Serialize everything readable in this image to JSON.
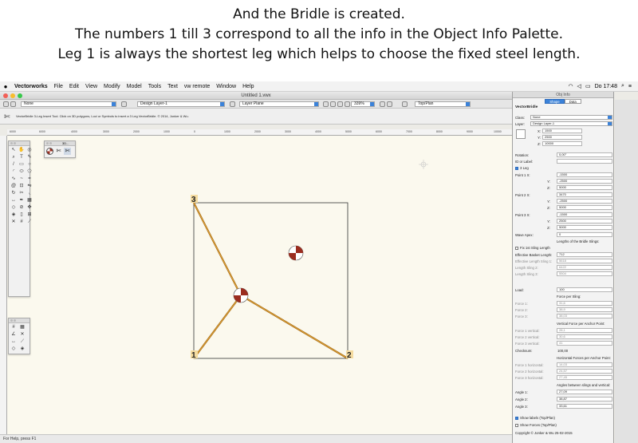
{
  "caption": {
    "line1": "And the Bridle is created.",
    "line2": "The numbers 1 till 3 correspond to all the info in the Object Info Palette.",
    "line3": "Leg 1 is always the shortest leg which helps to choose the fixed steel length."
  },
  "menubar": {
    "apple": "",
    "items": [
      "Vectorworks",
      "File",
      "Edit",
      "View",
      "Modify",
      "Model",
      "Tools",
      "Text",
      "vw remote",
      "Window",
      "Help"
    ],
    "clock": "Do 17:48"
  },
  "window": {
    "title": "Untitled 1.vwx"
  },
  "toolbar": {
    "class_select": "None",
    "layer_select": "Design Layer-1",
    "plane_select": "Layer Plane",
    "zoom": "339%",
    "view_select": "Top/Plan"
  },
  "modebar": {
    "message": "VectorBridle 3-Leg Insert Tool. Click on 3D polygons, Loci or Symbols to insert a 3 Leg VectorBridle. © 2014, Jonker & Wu."
  },
  "ruler": {
    "ticks": [
      "6000",
      "6000",
      "4000",
      "3000",
      "2000",
      "1000",
      "0",
      "1000",
      "2000",
      "3000",
      "4000",
      "5000",
      "6000",
      "7000",
      "8000",
      "9000",
      "10000"
    ]
  },
  "palette": {
    "title": "3D..."
  },
  "status": {
    "text": "For Help, press F1"
  },
  "drawing": {
    "point_labels": [
      "3",
      "1",
      "2"
    ],
    "line_color": "#c8861e",
    "marker_dark": "#9b2d1f"
  },
  "oip": {
    "title": "Obj Info",
    "tabs": [
      "Shape",
      "Data"
    ],
    "object_name": "VectorBridle",
    "class_label": "Class:",
    "class_value": "None",
    "layer_label": "Layer:",
    "layer_value": "Design Layer-1",
    "x_label": "X:",
    "x_value": "1500",
    "y_label": "Y:",
    "y_value": "2500",
    "z_label": "Z:",
    "z_value": "10000",
    "rotation_label": "Rotation:",
    "rotation_value": "0,00°",
    "id_label": "ID or Label:",
    "three_leg_label": "3 Leg",
    "p1_label": "Point 1 X:",
    "p1x": "-1500",
    "p1y_label": "Y:",
    "p1y": "-2500",
    "p1z_label": "Z:",
    "p1z": "5000",
    "p2_label": "Point 2 X:",
    "p2x": "3470",
    "p2y_label": "Y:",
    "p2y": "-2500",
    "p2z_label": "Z:",
    "p2z": "5000",
    "p3_label": "Point 3 X:",
    "p3x": "-1500",
    "p3y_label": "Y:",
    "p3y": "2500",
    "p3z_label": "Z:",
    "p3z": "5000",
    "wave_label": "Wave Apex:",
    "wave_value": "0",
    "lengths_heading": "Lengths of the Bridle Slings:",
    "fix_label": "Fix 1st Sling Length",
    "esl_label": "Effective Basket Length:",
    "esl_value": "712",
    "es1_label": "Effective Length Sling 1:",
    "es1_value": "5618",
    "ls2_label": "Length Sling 2:",
    "ls2_value": "6422",
    "ls3_label": "Length Sling 3:",
    "ls3_value": "5504",
    "load_label": "Load:",
    "load_value": "100",
    "force_heading": "Force per Sling:",
    "f1_label": "Force 1:",
    "f1_value": "31,6",
    "f2_label": "Force 2:",
    "f2_value": "38,9",
    "f3_label": "Force 3:",
    "f3_value": "38,03",
    "vertical_heading": "Vertical Force per Anchor Point:",
    "fv1_label": "Force 1 vertical:",
    "fv1_value": "28,1",
    "fv2_label": "Force 2 vertical:",
    "fv2_value": "30,6",
    "fv3_label": "Force 3 vertical:",
    "fv3_value": "41",
    "checksum_label": "Checksum:",
    "checksum_value": "100,00",
    "horizontal_heading": "Horizontal Forces per Anchor Point:",
    "fh1_label": "Force 1 horizontal:",
    "fh1_value": "14,03",
    "fh2_label": "Force 2 horizontal:",
    "fh2_value": "24,57",
    "fh3_label": "Force 3 horizontal:",
    "fh3_value": "27,45",
    "angles_heading": "Angles between slings and vertical:",
    "a1_label": "Angle 1:",
    "a1_value": "27,09",
    "a2_label": "Angle 2:",
    "a2_value": "38,87",
    "a3_label": "Angle 3:",
    "a3_value": "33,61",
    "show_labels": "Show labels (Top/Plan)",
    "show_forces": "Show Forces (Top/Plan)",
    "copyright": "Copyright © Jonker & Wu 25-02-2015"
  }
}
